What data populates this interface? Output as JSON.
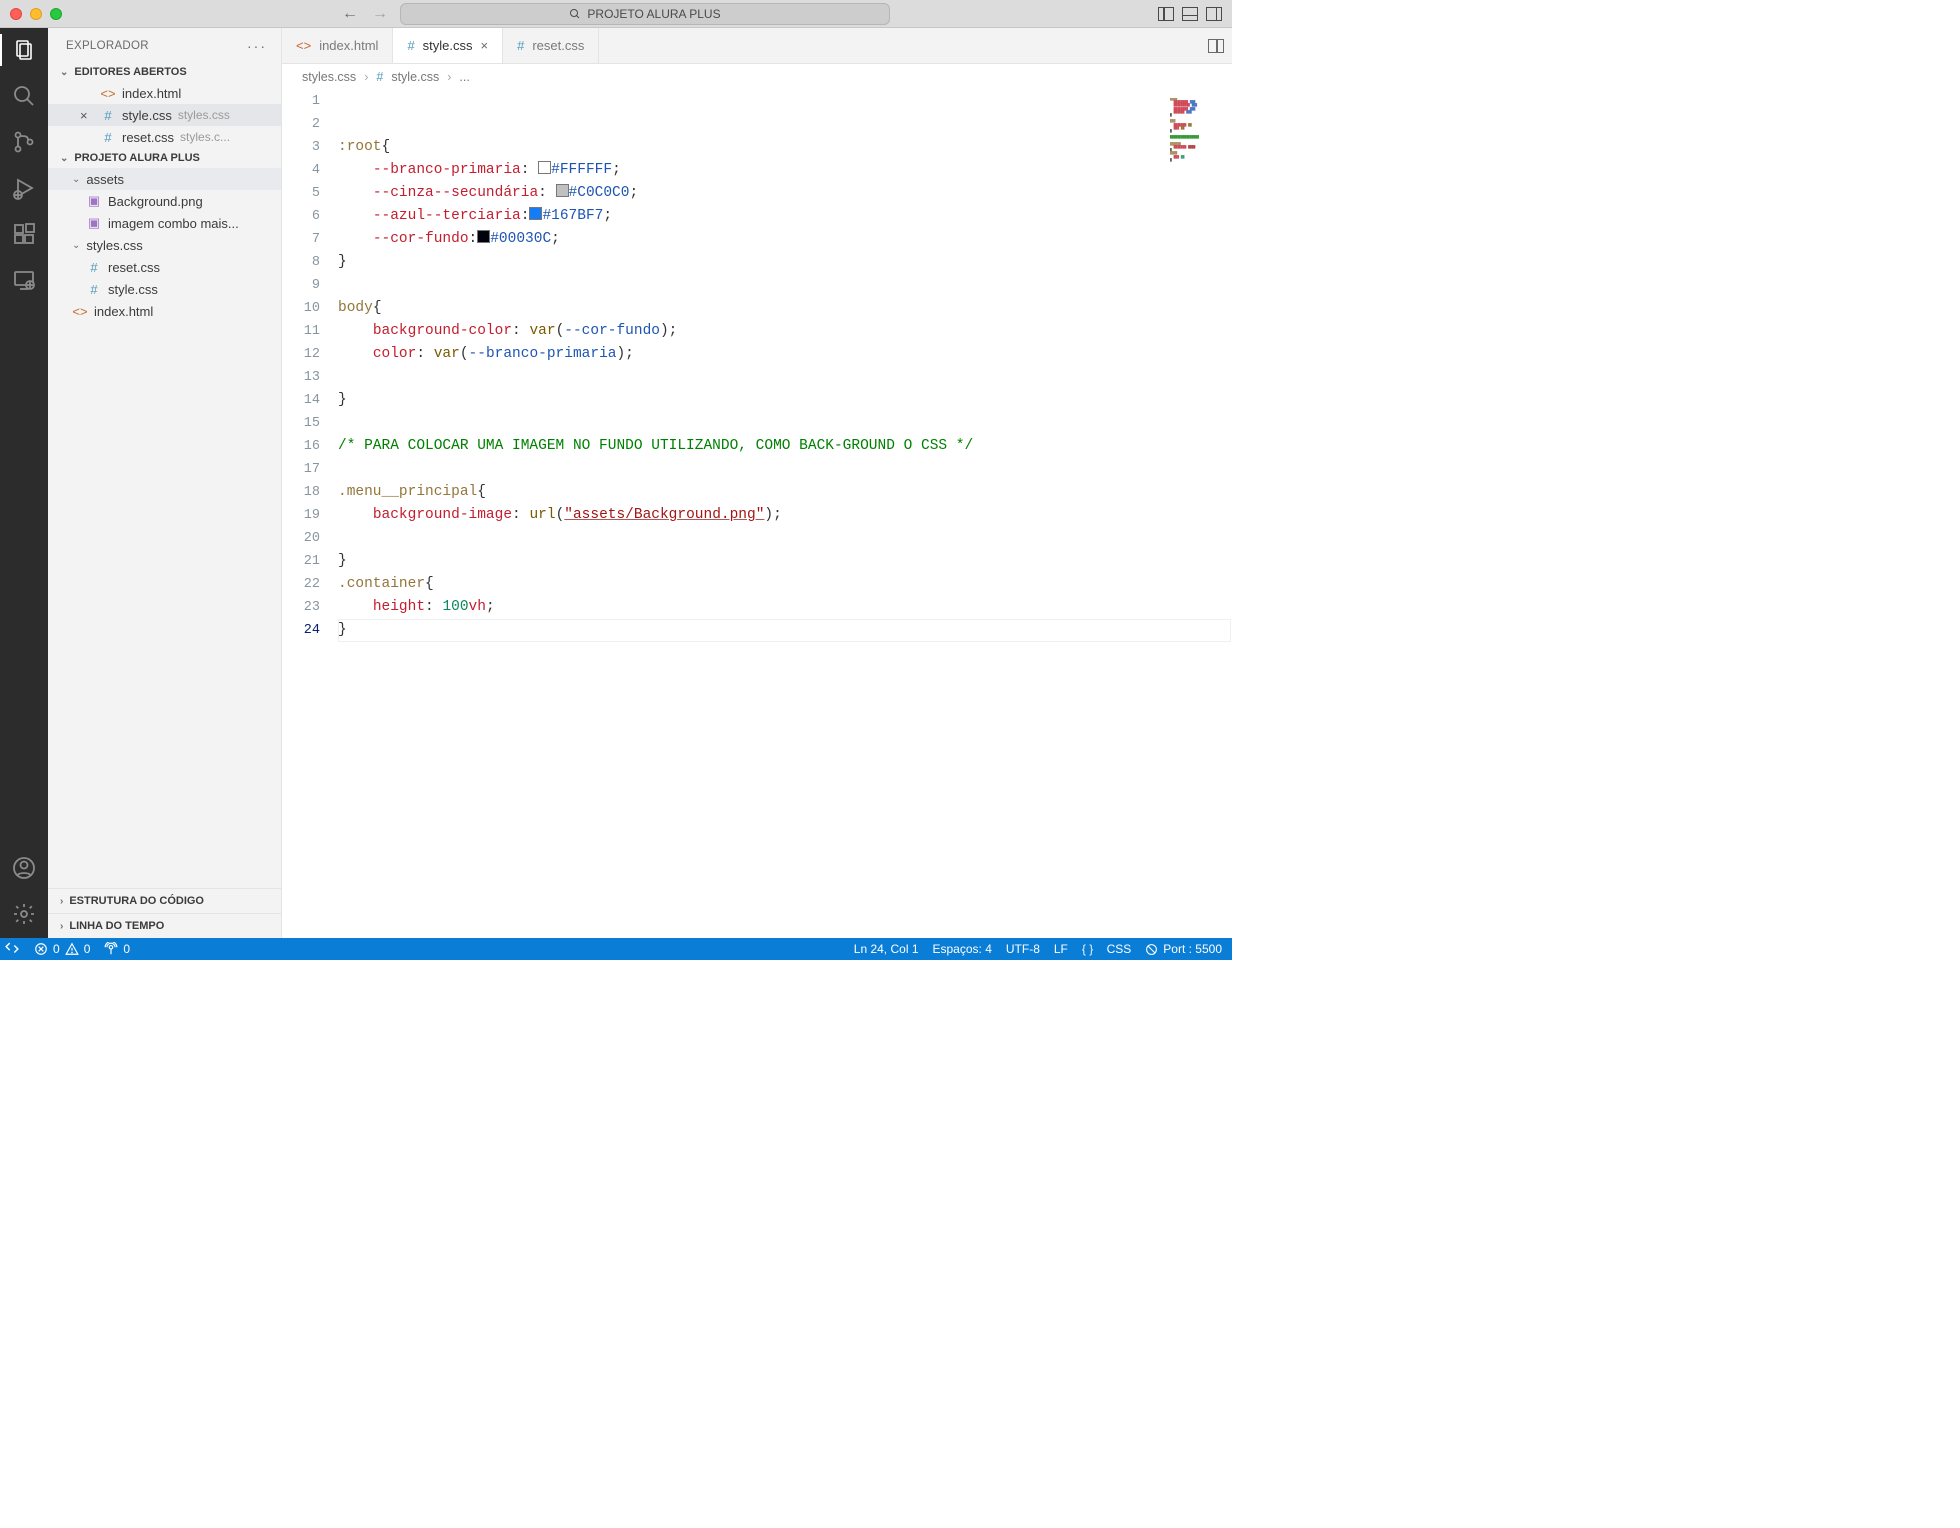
{
  "title": "PROJETO ALURA PLUS",
  "explorer_label": "EXPLORADOR",
  "open_editors_label": "EDITORES ABERTOS",
  "project_section_label": "PROJETO ALURA PLUS",
  "open_editors": [
    {
      "icon": "<>",
      "iconcolor": "orange",
      "label": "index.html",
      "tail": "",
      "prefix": ""
    },
    {
      "icon": "#",
      "iconcolor": "blue",
      "label": "style.css",
      "tail": "styles.css",
      "prefix": "×",
      "selected": true
    },
    {
      "icon": "#",
      "iconcolor": "blue",
      "label": "reset.css",
      "tail": "styles.c...",
      "prefix": ""
    }
  ],
  "files": {
    "folder_assets": "assets",
    "f_background": "Background.png",
    "f_imagem_combo": "imagem combo mais...",
    "folder_styles": "styles.css",
    "f_reset": "reset.css",
    "f_style": "style.css",
    "f_index": "index.html"
  },
  "outline_label": "ESTRUTURA DO CÓDIGO",
  "timeline_label": "LINHA DO TEMPO",
  "tabs": [
    {
      "icon": "<>",
      "iconcolor": "orange",
      "label": "index.html",
      "active": false,
      "close": false
    },
    {
      "icon": "#",
      "iconcolor": "blue",
      "label": "style.css",
      "active": true,
      "close": true
    },
    {
      "icon": "#",
      "iconcolor": "blue",
      "label": "reset.css",
      "active": false,
      "close": false
    }
  ],
  "breadcrumb": {
    "p1": "styles.css",
    "p2": "style.css",
    "p3": "...",
    "p2icon": "#"
  },
  "code": {
    "l1_sel": ":root",
    "l1_brace": "{",
    "l2_var": "--branco-primaria",
    "l2_colon": ": ",
    "l2_hex": "#FFFFFF",
    "l2_sc": ";",
    "l2_sw": "#FFFFFF",
    "l3_var": "--cinza--secundária",
    "l3_hex": "#C0C0C0",
    "l3_sw": "#C0C0C0",
    "l4_var": "--azul--terciaria",
    "l4_hex": "#167BF7",
    "l4_sw": "#167BF7",
    "l5_var": "--cor-fundo",
    "l5_hex": "#00030C",
    "l5_sw": "#00030C",
    "l6_brace": "}",
    "l8_sel": "body",
    "l8_brace": "{",
    "l9_prop": "background-color",
    "l9_func": "var",
    "l9_arg": "--cor-fundo",
    "l10_prop": "color",
    "l10_func": "var",
    "l10_arg": "--branco-primaria",
    "l12_brace": "}",
    "l14_comment": "/* PARA COLOCAR UMA IMAGEM NO FUNDO UTILIZANDO, COMO BACK-GROUND O CSS */",
    "l16_sel": ".menu__principal",
    "l16_brace": "{",
    "l17_prop": "background-image",
    "l17_func": "url",
    "l17_str": "\"assets/Background.png\"",
    "l19_brace": "}",
    "l20_sel": ".container",
    "l20_brace": "{",
    "l21_prop": "height",
    "l21_num": "100",
    "l21_unit": "vh",
    "l22_brace": "}"
  },
  "line_numbers": [
    "1",
    "2",
    "3",
    "4",
    "5",
    "6",
    "7",
    "8",
    "9",
    "10",
    "11",
    "12",
    "13",
    "14",
    "15",
    "16",
    "17",
    "18",
    "19",
    "20",
    "21",
    "22",
    "23",
    "24"
  ],
  "status": {
    "errors": "0",
    "warnings": "0",
    "radio": "0",
    "ln_col": "Ln 24, Col 1",
    "spaces": "Espaços: 4",
    "encoding": "UTF-8",
    "eol": "LF",
    "lang": "CSS",
    "port": "Port : 5500"
  }
}
